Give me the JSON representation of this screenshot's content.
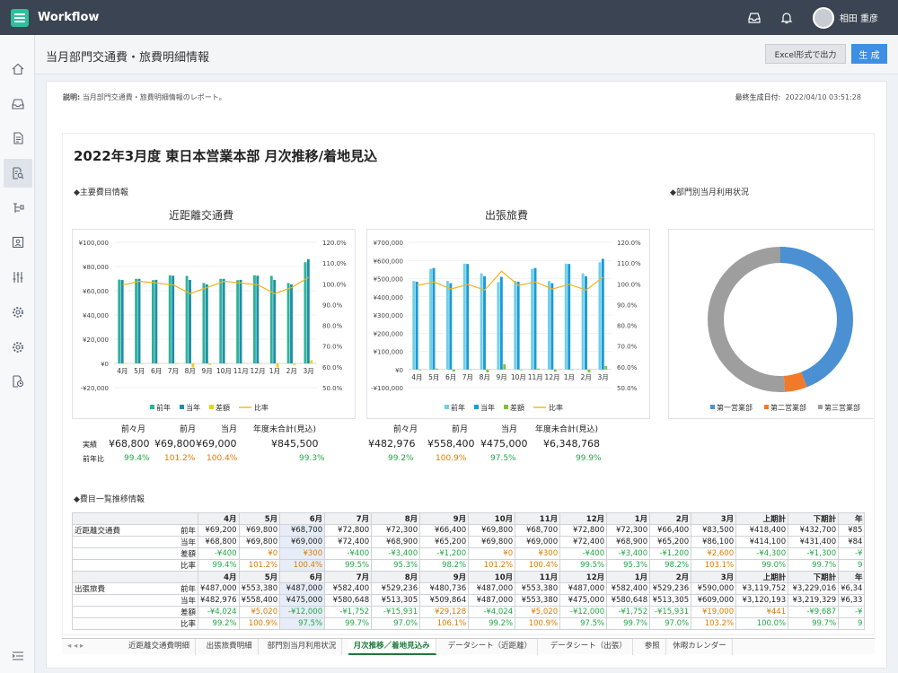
{
  "app": {
    "name": "Workflow",
    "user": "相田 重彦"
  },
  "header": {
    "title": "当月部門交通費・旅費明細情報",
    "excel_label": "Excel形式で出力",
    "generate_label": "生 成"
  },
  "info": {
    "desc_label": "説明:",
    "desc": "当月部門交通費・旅費明細情報のレポート。",
    "date_label": "最終生成日付:",
    "date": "2022/04/10 03:51:28"
  },
  "report": {
    "title": "2022年3月度 東日本営業本部 月次推移/着地見込",
    "sec_main": "◆主要費目情報",
    "sec_dept": "◆部門別当月利用状況",
    "sec_list": "◆費目一覧推移情報"
  },
  "chart_data": [
    {
      "type": "bar",
      "title": "近距離交通費",
      "categories": [
        "4月",
        "5月",
        "6月",
        "7月",
        "8月",
        "9月",
        "10月",
        "11月",
        "12月",
        "1月",
        "2月",
        "3月"
      ],
      "ylim": [
        -20000,
        100000
      ],
      "y2lim": [
        50,
        120
      ],
      "y_ticks": [
        "¥100,000",
        "¥80,000",
        "¥60,000",
        "¥40,000",
        "¥20,000",
        "¥0",
        "-¥20,000"
      ],
      "y2_ticks": [
        "120.0%",
        "110.0%",
        "100.0%",
        "90.0%",
        "80.0%",
        "70.0%",
        "60.0%",
        "50.0%"
      ],
      "series": [
        {
          "name": "前年",
          "color": "#2fb39a",
          "values": [
            69200,
            69800,
            68700,
            72800,
            72300,
            66400,
            69800,
            68700,
            72800,
            72300,
            66400,
            83500
          ]
        },
        {
          "name": "当年",
          "color": "#1f8fa6",
          "values": [
            68800,
            69800,
            69000,
            72400,
            68900,
            65200,
            69800,
            69000,
            72400,
            68900,
            65200,
            86100
          ]
        },
        {
          "name": "差額",
          "color": "#e8d21a",
          "values": [
            -400,
            0,
            300,
            -400,
            -3400,
            -1200,
            0,
            300,
            -400,
            -3400,
            -1200,
            2600
          ]
        },
        {
          "name": "比率",
          "color": "#f2b318",
          "type": "line",
          "values": [
            99.4,
            101.2,
            100.4,
            99.5,
            95.3,
            98.2,
            101.2,
            100.4,
            99.5,
            95.3,
            98.2,
            103.1
          ]
        }
      ]
    },
    {
      "type": "bar",
      "title": "出張旅費",
      "categories": [
        "4月",
        "5月",
        "6月",
        "7月",
        "8月",
        "9月",
        "10月",
        "11月",
        "12月",
        "1月",
        "2月",
        "3月"
      ],
      "ylim": [
        -100000,
        700000
      ],
      "y2lim": [
        50,
        120
      ],
      "y_ticks": [
        "¥700,000",
        "¥600,000",
        "¥500,000",
        "¥400,000",
        "¥300,000",
        "¥200,000",
        "¥100,000",
        "¥0",
        "-¥100,000"
      ],
      "y2_ticks": [
        "120.0%",
        "110.0%",
        "100.0%",
        "90.0%",
        "80.0%",
        "70.0%",
        "60.0%",
        "50.0%"
      ],
      "series": [
        {
          "name": "前年",
          "color": "#6fd0e8",
          "values": [
            487000,
            553380,
            487000,
            582400,
            529236,
            480736,
            487000,
            553380,
            487000,
            582400,
            529236,
            590000
          ]
        },
        {
          "name": "当年",
          "color": "#1a9ad8",
          "values": [
            482976,
            558400,
            475000,
            580648,
            513305,
            509864,
            482976,
            558400,
            475000,
            580648,
            513305,
            609000
          ]
        },
        {
          "name": "差額",
          "color": "#7ec23a",
          "values": [
            -4024,
            5020,
            -12000,
            -1752,
            -15931,
            29128,
            -4024,
            5020,
            -12000,
            -1752,
            -15931,
            19000
          ]
        },
        {
          "name": "比率",
          "color": "#f2b318",
          "type": "line",
          "values": [
            99.2,
            100.9,
            97.5,
            99.7,
            97.0,
            106.1,
            99.2,
            100.9,
            97.5,
            99.7,
            97.0,
            103.2
          ]
        }
      ]
    },
    {
      "type": "pie",
      "title": "",
      "series": [
        {
          "name": "第一営業部",
          "color": "#4a90d2",
          "value": 44
        },
        {
          "name": "第二営業部",
          "color": "#f07a2a",
          "value": 5
        },
        {
          "name": "第三営業部",
          "color": "#9e9e9e",
          "value": 51
        }
      ]
    }
  ],
  "summary": {
    "h1": "前々月",
    "h2": "前月",
    "h3": "当月",
    "h4": "年度未合計(見込)",
    "r1": "実績",
    "r2": "前年比",
    "transit": {
      "v1": "¥68,800",
      "v2": "¥69,800",
      "v3": "¥69,000",
      "v4": "¥845,500",
      "p1": "99.4%",
      "p2": "101.2%",
      "p3": "100.4%",
      "p4": "99.3%"
    },
    "travel": {
      "v1": "¥482,976",
      "v2": "¥558,400",
      "v3": "¥475,000",
      "v4": "¥6,348,768",
      "p1": "99.2%",
      "p2": "100.9%",
      "p3": "97.5%",
      "p4": "99.9%"
    }
  },
  "table": {
    "headers": [
      "4月",
      "5月",
      "6月",
      "7月",
      "8月",
      "9月",
      "10月",
      "11月",
      "12月",
      "1月",
      "2月",
      "3月",
      "上期計",
      "下期計",
      "年"
    ],
    "groups": [
      {
        "name": "近距離交通費",
        "rows": [
          {
            "label": "前年",
            "cells": [
              "¥69,200",
              "¥69,800",
              "¥68,700",
              "¥72,800",
              "¥72,300",
              "¥66,400",
              "¥69,800",
              "¥68,700",
              "¥72,800",
              "¥72,300",
              "¥66,400",
              "¥83,500",
              "¥418,400",
              "¥432,700",
              "¥85"
            ]
          },
          {
            "label": "当年",
            "cells": [
              "¥68,800",
              "¥69,800",
              "¥69,000",
              "¥72,400",
              "¥68,900",
              "¥65,200",
              "¥69,800",
              "¥69,000",
              "¥72,400",
              "¥68,900",
              "¥65,200",
              "¥86,100",
              "¥414,100",
              "¥431,400",
              "¥84"
            ]
          },
          {
            "label": "差額",
            "cells": [
              "-¥400",
              "¥0",
              "¥300",
              "-¥400",
              "-¥3,400",
              "-¥1,200",
              "¥0",
              "¥300",
              "-¥400",
              "-¥3,400",
              "-¥1,200",
              "¥2,600",
              "-¥4,300",
              "-¥1,300",
              "-¥"
            ]
          },
          {
            "label": "比率",
            "cells": [
              "99.4%",
              "101.2%",
              "100.4%",
              "99.5%",
              "95.3%",
              "98.2%",
              "101.2%",
              "100.4%",
              "99.5%",
              "95.3%",
              "98.2%",
              "103.1%",
              "99.0%",
              "99.7%",
              "9"
            ]
          }
        ]
      },
      {
        "name": "出張旅費",
        "rows": [
          {
            "label": "前年",
            "cells": [
              "¥487,000",
              "¥553,380",
              "¥487,000",
              "¥582,400",
              "¥529,236",
              "¥480,736",
              "¥487,000",
              "¥553,380",
              "¥487,000",
              "¥582,400",
              "¥529,236",
              "¥590,000",
              "¥3,119,752",
              "¥3,229,016",
              "¥6,34"
            ]
          },
          {
            "label": "当年",
            "cells": [
              "¥482,976",
              "¥558,400",
              "¥475,000",
              "¥580,648",
              "¥513,305",
              "¥509,864",
              "¥487,000",
              "¥553,380",
              "¥475,000",
              "¥580,648",
              "¥513,305",
              "¥609,000",
              "¥3,120,193",
              "¥3,219,329",
              "¥6,33"
            ]
          },
          {
            "label": "差額",
            "cells": [
              "-¥4,024",
              "¥5,020",
              "-¥12,000",
              "-¥1,752",
              "-¥15,931",
              "¥29,128",
              "-¥4,024",
              "¥5,020",
              "-¥12,000",
              "-¥1,752",
              "-¥15,931",
              "¥19,000",
              "¥441",
              "-¥9,687",
              "-¥"
            ]
          },
          {
            "label": "比率",
            "cells": [
              "99.2%",
              "100.9%",
              "97.5%",
              "99.7%",
              "97.0%",
              "106.1%",
              "99.2%",
              "100.9%",
              "97.5%",
              "99.7%",
              "97.0%",
              "103.2%",
              "100.0%",
              "99.7%",
              "9"
            ]
          }
        ]
      }
    ]
  },
  "tabs": [
    "近距離交通費明細",
    "出張旅費明細",
    "部門別当月利用状況",
    "月次推移／着地見込み",
    "データシート（近距離）",
    "データシート（出張）",
    "参照",
    "休暇カレンダー"
  ]
}
